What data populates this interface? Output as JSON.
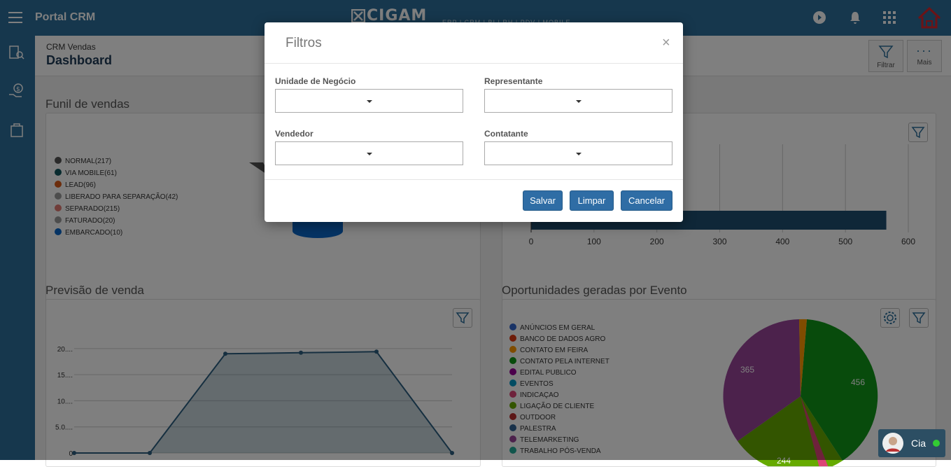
{
  "topbar": {
    "app_title": "Portal CRM",
    "logo_text": "CIGAM",
    "logo_sub": "ERP | CRM | BI | RH | PDV | MOBILE"
  },
  "header": {
    "breadcrumb": "CRM Vendas",
    "title": "Dashboard",
    "filter_label": "Filtrar",
    "more_label": "Mais"
  },
  "sections": {
    "funnel_title": "Funil de vendas",
    "forecast_title": "Previsão de venda",
    "events_title": "Oportunidades geradas por Evento"
  },
  "funnel_legend": [
    {
      "label": "NORMAL(217)",
      "color": "#555555"
    },
    {
      "label": "VIA MOBILE(61)",
      "color": "#11575f"
    },
    {
      "label": "LEAD(96)",
      "color": "#d85a18"
    },
    {
      "label": "LIBERADO PARA SEPARAÇÃO(42)",
      "color": "#9a9a9a"
    },
    {
      "label": "SEPARADO(215)",
      "color": "#e07a72"
    },
    {
      "label": "FATURADO(20)",
      "color": "#9a9a9a"
    },
    {
      "label": "EMBARCADO(10)",
      "color": "#0a67c8"
    }
  ],
  "bar_chart": {
    "ticks": [
      "0",
      "100",
      "200",
      "300",
      "400",
      "500",
      "600"
    ],
    "value": 565,
    "max": 600
  },
  "line_chart": {
    "yticks": [
      "20....",
      "15....",
      "10....",
      "5.0....",
      "0"
    ],
    "values": [
      0,
      0,
      19,
      19.2,
      19.4,
      0
    ],
    "ymax": 24
  },
  "event_legend": [
    {
      "label": "ANÚNCIOS EM GERAL",
      "color": "#3366cc"
    },
    {
      "label": "BANCO DE DADOS AGRO",
      "color": "#dc3912"
    },
    {
      "label": "CONTATO EM FEIRA",
      "color": "#ff9900"
    },
    {
      "label": "CONTATO PELA INTERNET",
      "color": "#109618"
    },
    {
      "label": "EDITAL PUBLICO",
      "color": "#990099"
    },
    {
      "label": "EVENTOS",
      "color": "#0099c6"
    },
    {
      "label": "INDICAÇAO",
      "color": "#dd4477"
    },
    {
      "label": "LIGAÇÃO DE CLIENTE",
      "color": "#66aa00"
    },
    {
      "label": "OUTDOOR",
      "color": "#b82e2e"
    },
    {
      "label": "PALESTRA",
      "color": "#316395"
    },
    {
      "label": "TELEMARKETING",
      "color": "#994499"
    },
    {
      "label": "TRABALHO PÓS-VENDA",
      "color": "#22aa99"
    }
  ],
  "pie_labels": {
    "a": "456",
    "b": "365",
    "c": "244"
  },
  "modal": {
    "title": "Filtros",
    "close": "×",
    "unit_label": "Unidade de Negócio",
    "rep_label": "Representante",
    "seller_label": "Vendedor",
    "contact_label": "Contatante",
    "save": "Salvar",
    "clear": "Limpar",
    "cancel": "Cancelar"
  },
  "chat": {
    "label": "Cia"
  }
}
